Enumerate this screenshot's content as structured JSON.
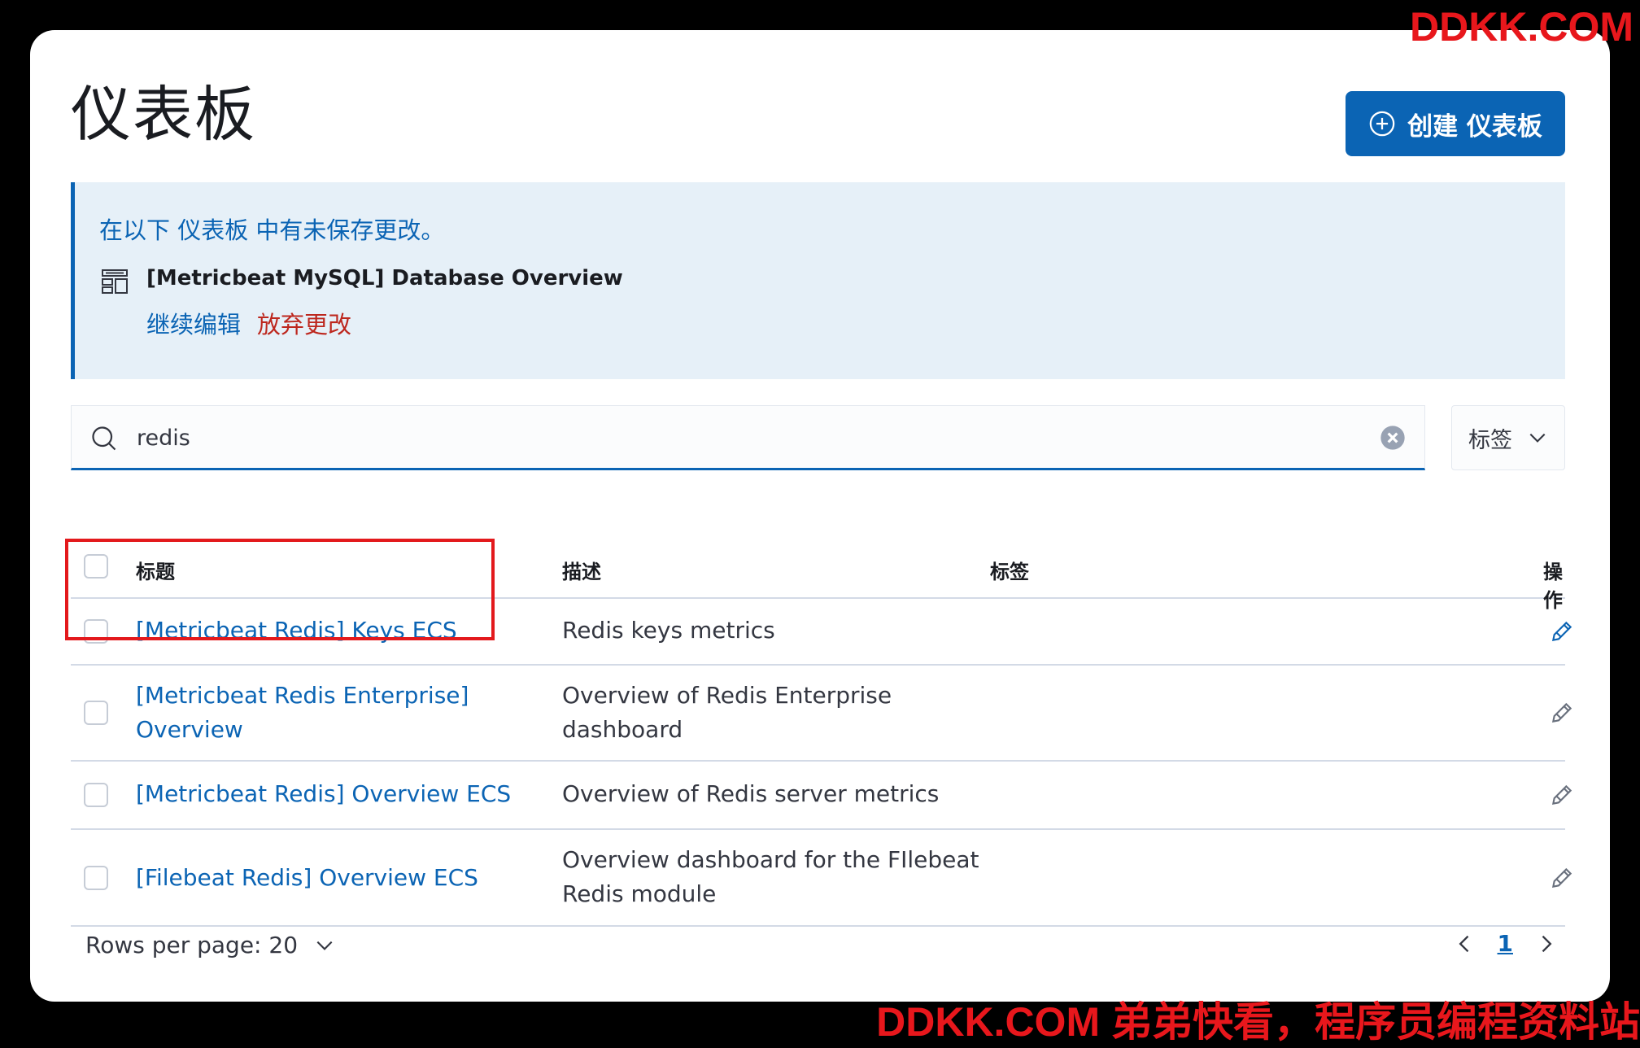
{
  "page": {
    "title": "仪表板",
    "create_button_label": "创建 仪表板"
  },
  "callout": {
    "title": "在以下 仪表板 中有未保存更改。",
    "item_title": "[Metricbeat MySQL] Database Overview",
    "continue_label": "继续编辑",
    "discard_label": "放弃更改"
  },
  "search": {
    "value": "redis"
  },
  "tags_filter": {
    "label": "标签"
  },
  "table": {
    "columns": {
      "title": "标题",
      "description": "描述",
      "tags": "标签",
      "actions": "操作"
    },
    "rows": [
      {
        "title": "[Metricbeat Redis] Keys ECS",
        "description": "Redis keys metrics"
      },
      {
        "title": "[Metricbeat Redis Enterprise] Overview",
        "description": "Overview of Redis Enterprise dashboard"
      },
      {
        "title": "[Metricbeat Redis] Overview ECS",
        "description": "Overview of Redis server metrics"
      },
      {
        "title": "[Filebeat Redis] Overview ECS",
        "description": "Overview dashboard for the FIlebeat Redis module"
      }
    ]
  },
  "pagination": {
    "rows_per_page": "Rows per page: 20",
    "current_page": "1"
  },
  "watermark": {
    "top": "DDKK.COM",
    "bottom": "DDKK.COM 弟弟快看，程序员编程资料站"
  },
  "colors": {
    "primary": "#0b64b4",
    "danger": "#bd271e",
    "highlight": "#e3191c"
  }
}
